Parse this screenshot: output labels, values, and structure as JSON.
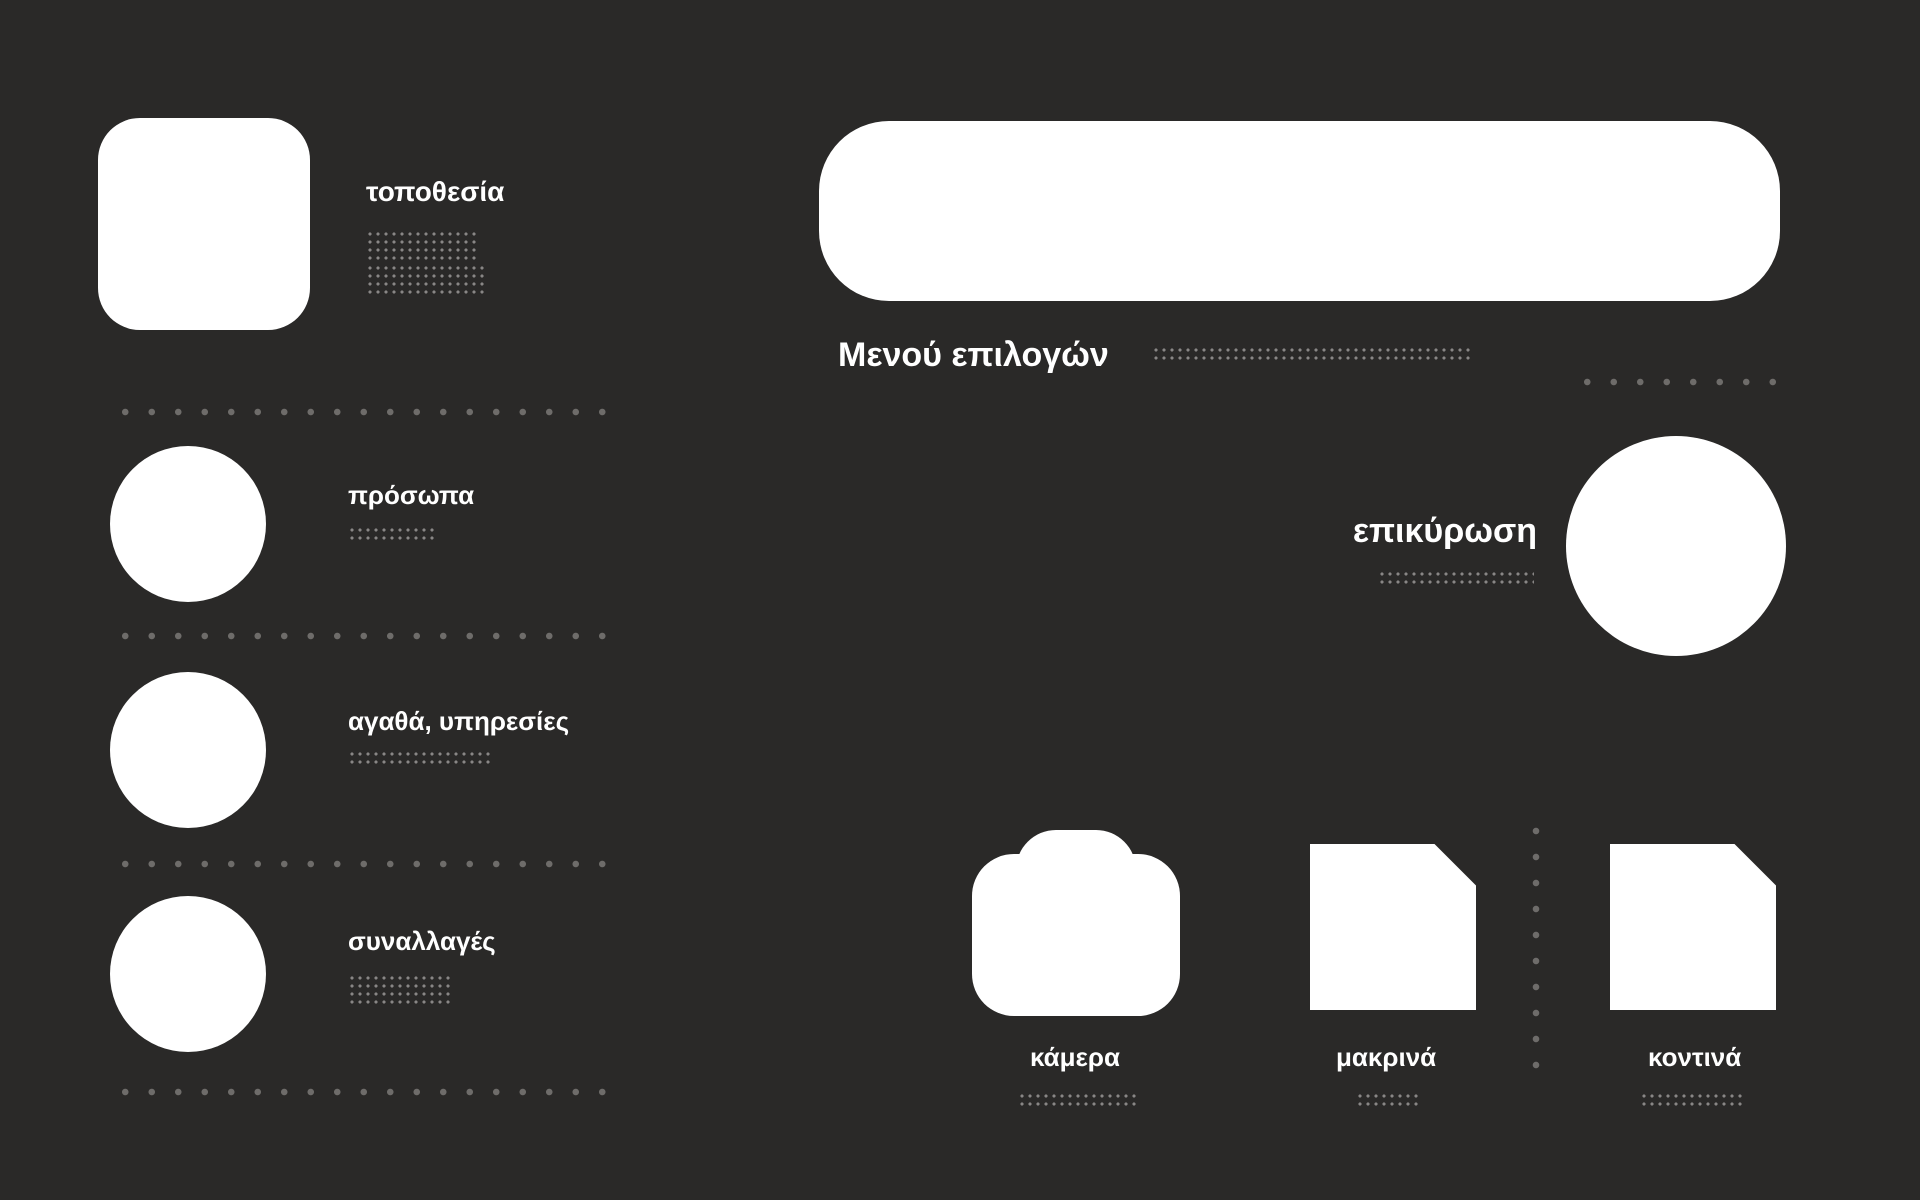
{
  "left_menu": {
    "location": {
      "label": "τοποθεσία",
      "shape": "rounded-square-icon"
    },
    "people": {
      "label": "πρόσωπα",
      "shape": "circle-icon"
    },
    "goods_services": {
      "label": "αγαθά, υπηρεσίες",
      "shape": "circle-icon"
    },
    "transactions": {
      "label": "συναλλαγές",
      "shape": "circle-icon"
    }
  },
  "top_bar": {
    "menu_label": "Μενού επιλογών"
  },
  "confirm": {
    "label": "επικύρωση"
  },
  "bottom_controls": {
    "camera_label": "κάμερα",
    "far_label": "μακρινά",
    "near_label": "κοντινά"
  },
  "colors": {
    "background": "#2a2928",
    "foreground": "#ffffff",
    "braille_dots": "#9a9896",
    "separator_dots": "#6e6c6a"
  }
}
